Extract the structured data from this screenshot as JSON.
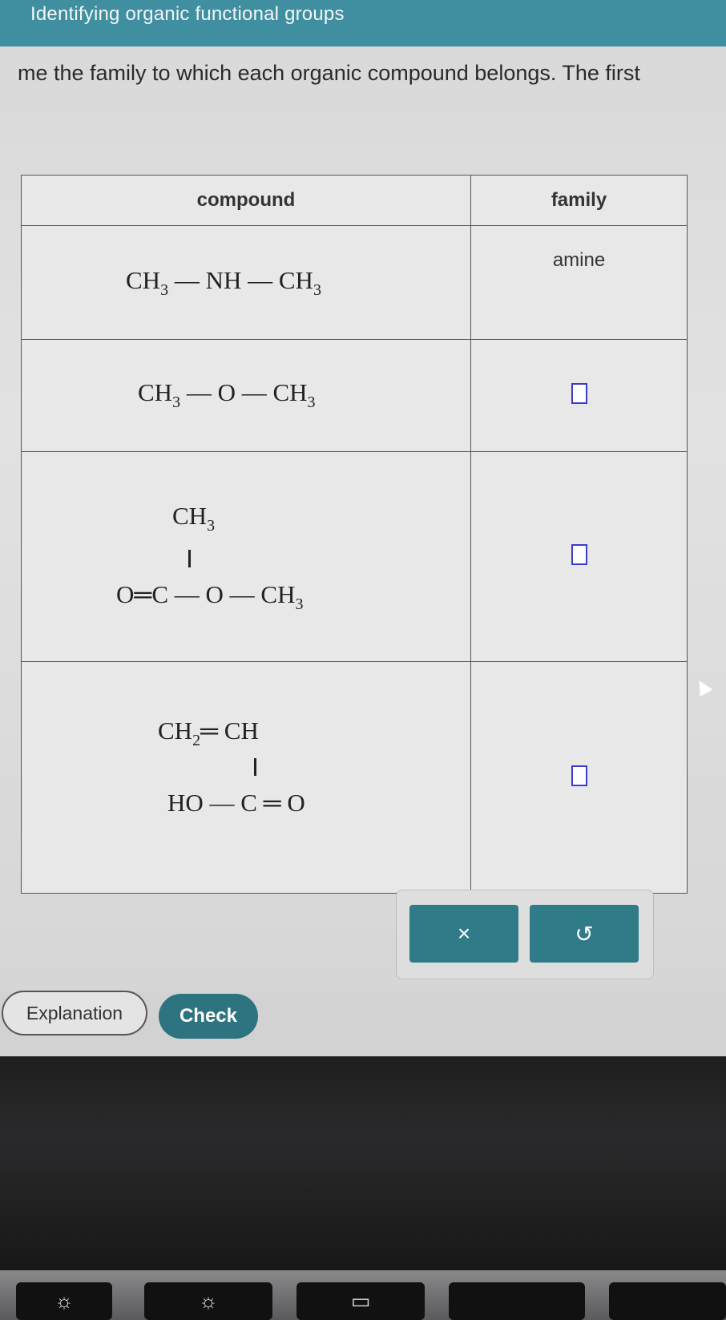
{
  "header": {
    "title": "Identifying organic functional groups"
  },
  "instruction": "me the family to which each organic compound belongs. The first",
  "table": {
    "col_compound": "compound",
    "col_family": "family",
    "rows": [
      {
        "formula": {
          "a": "CH",
          "a_sub": "3",
          "b": "— NH —",
          "c": "CH",
          "c_sub": "3"
        },
        "family": "amine"
      },
      {
        "formula": {
          "a": "CH",
          "a_sub": "3",
          "b": "— O —",
          "c": "CH",
          "c_sub": "3"
        },
        "family": ""
      },
      {
        "formula": {
          "top": "CH",
          "top_sub": "3",
          "main": "O═C — O —",
          "end": "CH",
          "end_sub": "3"
        },
        "family": ""
      },
      {
        "formula": {
          "top": "CH",
          "top_sub": "2",
          "top_rest": "═ CH",
          "bottom": "HO — C ═ O"
        },
        "family": ""
      }
    ]
  },
  "buttons": {
    "clear": "×",
    "undo": "↺",
    "explanation": "Explanation",
    "check": "Check"
  },
  "icons": {
    "brightness": "brightness-icon",
    "cursor": "mouse-cursor-icon"
  },
  "colors": {
    "header_bg": "#3f8fa0",
    "button_teal": "#2f7b88",
    "answer_box_border": "#3b3bd0"
  }
}
